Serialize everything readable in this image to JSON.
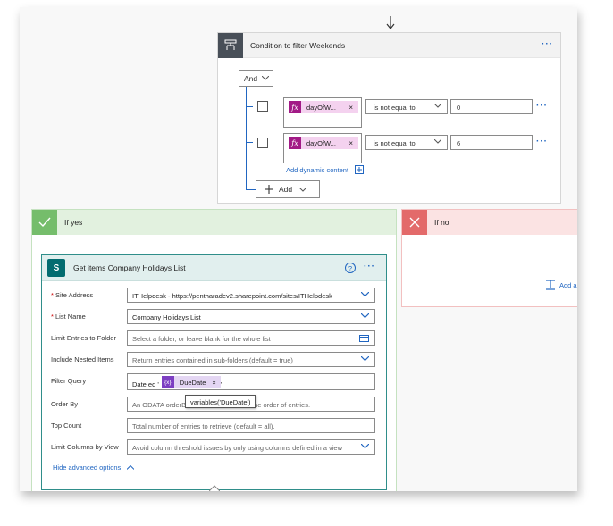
{
  "condition": {
    "title": "Condition to filter Weekends",
    "more": "···",
    "operator": "And",
    "rows": [
      {
        "token": "dayOfW...",
        "remove": "×",
        "comparison": "is not equal to",
        "value": "0",
        "more": "···"
      },
      {
        "token": "dayOfW...",
        "remove": "×",
        "comparison": "is not equal to",
        "value": "6",
        "more": "···"
      }
    ],
    "add_dynamic_content": "Add dynamic content",
    "add_label": "Add"
  },
  "if_yes": {
    "label": "If yes"
  },
  "if_no": {
    "label": "If no",
    "add_action_partial": "Add a"
  },
  "get_items": {
    "title": "Get items Company Holidays List",
    "help": "?",
    "more": "···",
    "fields": {
      "site_address": {
        "label": "Site Address",
        "required": "*",
        "value": "ITHelpdesk - https://pentharadev2.sharepoint.com/sites/ITHelpdesk"
      },
      "list_name": {
        "label": "List Name",
        "required": "*",
        "value": "Company Holidays List"
      },
      "limit_folder": {
        "label": "Limit Entries to Folder",
        "placeholder": "Select a folder, or leave blank for the whole list"
      },
      "include_nested": {
        "label": "Include Nested Items",
        "value": "Return entries contained in sub-folders (default = true)"
      },
      "filter_query": {
        "label": "Filter Query",
        "prefix": "Date eq '",
        "token": "DueDate",
        "token_icon": "{x}",
        "remove": "×",
        "suffix": "'"
      },
      "order_by": {
        "label": "Order By",
        "placeholder_start": "An ODATA orderB",
        "placeholder_end": "the order of entries."
      },
      "top_count": {
        "label": "Top Count",
        "placeholder": "Total number of entries to retrieve (default = all)."
      },
      "limit_columns": {
        "label": "Limit Columns by View",
        "value": "Avoid column threshold issues by only using columns defined in a view"
      }
    },
    "tooltip": "variables('DueDate')",
    "hide_advanced": "Hide advanced options"
  }
}
